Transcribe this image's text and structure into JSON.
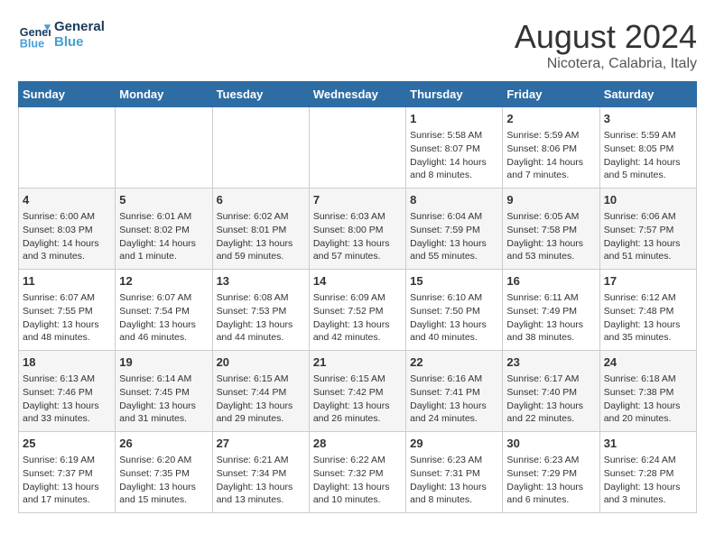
{
  "header": {
    "logo_line1": "General",
    "logo_line2": "Blue",
    "main_title": "August 2024",
    "subtitle": "Nicotera, Calabria, Italy"
  },
  "days_of_week": [
    "Sunday",
    "Monday",
    "Tuesday",
    "Wednesday",
    "Thursday",
    "Friday",
    "Saturday"
  ],
  "weeks": [
    [
      {
        "day": "",
        "detail": ""
      },
      {
        "day": "",
        "detail": ""
      },
      {
        "day": "",
        "detail": ""
      },
      {
        "day": "",
        "detail": ""
      },
      {
        "day": "1",
        "detail": "Sunrise: 5:58 AM\nSunset: 8:07 PM\nDaylight: 14 hours\nand 8 minutes."
      },
      {
        "day": "2",
        "detail": "Sunrise: 5:59 AM\nSunset: 8:06 PM\nDaylight: 14 hours\nand 7 minutes."
      },
      {
        "day": "3",
        "detail": "Sunrise: 5:59 AM\nSunset: 8:05 PM\nDaylight: 14 hours\nand 5 minutes."
      }
    ],
    [
      {
        "day": "4",
        "detail": "Sunrise: 6:00 AM\nSunset: 8:03 PM\nDaylight: 14 hours\nand 3 minutes."
      },
      {
        "day": "5",
        "detail": "Sunrise: 6:01 AM\nSunset: 8:02 PM\nDaylight: 14 hours\nand 1 minute."
      },
      {
        "day": "6",
        "detail": "Sunrise: 6:02 AM\nSunset: 8:01 PM\nDaylight: 13 hours\nand 59 minutes."
      },
      {
        "day": "7",
        "detail": "Sunrise: 6:03 AM\nSunset: 8:00 PM\nDaylight: 13 hours\nand 57 minutes."
      },
      {
        "day": "8",
        "detail": "Sunrise: 6:04 AM\nSunset: 7:59 PM\nDaylight: 13 hours\nand 55 minutes."
      },
      {
        "day": "9",
        "detail": "Sunrise: 6:05 AM\nSunset: 7:58 PM\nDaylight: 13 hours\nand 53 minutes."
      },
      {
        "day": "10",
        "detail": "Sunrise: 6:06 AM\nSunset: 7:57 PM\nDaylight: 13 hours\nand 51 minutes."
      }
    ],
    [
      {
        "day": "11",
        "detail": "Sunrise: 6:07 AM\nSunset: 7:55 PM\nDaylight: 13 hours\nand 48 minutes."
      },
      {
        "day": "12",
        "detail": "Sunrise: 6:07 AM\nSunset: 7:54 PM\nDaylight: 13 hours\nand 46 minutes."
      },
      {
        "day": "13",
        "detail": "Sunrise: 6:08 AM\nSunset: 7:53 PM\nDaylight: 13 hours\nand 44 minutes."
      },
      {
        "day": "14",
        "detail": "Sunrise: 6:09 AM\nSunset: 7:52 PM\nDaylight: 13 hours\nand 42 minutes."
      },
      {
        "day": "15",
        "detail": "Sunrise: 6:10 AM\nSunset: 7:50 PM\nDaylight: 13 hours\nand 40 minutes."
      },
      {
        "day": "16",
        "detail": "Sunrise: 6:11 AM\nSunset: 7:49 PM\nDaylight: 13 hours\nand 38 minutes."
      },
      {
        "day": "17",
        "detail": "Sunrise: 6:12 AM\nSunset: 7:48 PM\nDaylight: 13 hours\nand 35 minutes."
      }
    ],
    [
      {
        "day": "18",
        "detail": "Sunrise: 6:13 AM\nSunset: 7:46 PM\nDaylight: 13 hours\nand 33 minutes."
      },
      {
        "day": "19",
        "detail": "Sunrise: 6:14 AM\nSunset: 7:45 PM\nDaylight: 13 hours\nand 31 minutes."
      },
      {
        "day": "20",
        "detail": "Sunrise: 6:15 AM\nSunset: 7:44 PM\nDaylight: 13 hours\nand 29 minutes."
      },
      {
        "day": "21",
        "detail": "Sunrise: 6:15 AM\nSunset: 7:42 PM\nDaylight: 13 hours\nand 26 minutes."
      },
      {
        "day": "22",
        "detail": "Sunrise: 6:16 AM\nSunset: 7:41 PM\nDaylight: 13 hours\nand 24 minutes."
      },
      {
        "day": "23",
        "detail": "Sunrise: 6:17 AM\nSunset: 7:40 PM\nDaylight: 13 hours\nand 22 minutes."
      },
      {
        "day": "24",
        "detail": "Sunrise: 6:18 AM\nSunset: 7:38 PM\nDaylight: 13 hours\nand 20 minutes."
      }
    ],
    [
      {
        "day": "25",
        "detail": "Sunrise: 6:19 AM\nSunset: 7:37 PM\nDaylight: 13 hours\nand 17 minutes."
      },
      {
        "day": "26",
        "detail": "Sunrise: 6:20 AM\nSunset: 7:35 PM\nDaylight: 13 hours\nand 15 minutes."
      },
      {
        "day": "27",
        "detail": "Sunrise: 6:21 AM\nSunset: 7:34 PM\nDaylight: 13 hours\nand 13 minutes."
      },
      {
        "day": "28",
        "detail": "Sunrise: 6:22 AM\nSunset: 7:32 PM\nDaylight: 13 hours\nand 10 minutes."
      },
      {
        "day": "29",
        "detail": "Sunrise: 6:23 AM\nSunset: 7:31 PM\nDaylight: 13 hours\nand 8 minutes."
      },
      {
        "day": "30",
        "detail": "Sunrise: 6:23 AM\nSunset: 7:29 PM\nDaylight: 13 hours\nand 6 minutes."
      },
      {
        "day": "31",
        "detail": "Sunrise: 6:24 AM\nSunset: 7:28 PM\nDaylight: 13 hours\nand 3 minutes."
      }
    ]
  ]
}
